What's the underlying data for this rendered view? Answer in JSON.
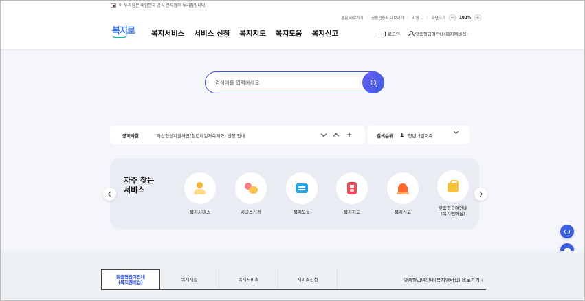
{
  "gov_banner": {
    "text": "이 누리집은 대한민국 공식 전자정부 누리집입니다."
  },
  "utility": {
    "skip": "본문 바로가기",
    "cert": "공동인증서 내보내기",
    "region": "지원",
    "zoom_label": "화면크기",
    "zoom_value": "100%",
    "zoom_out": "−",
    "zoom_in": "+"
  },
  "logo": {
    "text": "복지로"
  },
  "gnb": [
    "복지서비스",
    "서비스 신청",
    "복지지도",
    "복지도움",
    "복지신고"
  ],
  "member": {
    "login": "로그인",
    "membership": "맞춤형급여안내(복지멤버십)"
  },
  "search": {
    "placeholder": "검색어를 입력하세요"
  },
  "notice": {
    "label": "공지사항",
    "text": "자산형성지원사업(청년내일저축계좌) 신청 안내",
    "plus": "+"
  },
  "ranking": {
    "label": "검색순위",
    "rank": "1",
    "keyword": "청년내일저축"
  },
  "frequent": {
    "title": "자주 찾는\n서비스",
    "items": [
      {
        "label": "복지서비스",
        "icon": "people-icon"
      },
      {
        "label": "서비스신청",
        "icon": "hand-icon"
      },
      {
        "label": "복지도움",
        "icon": "book-icon"
      },
      {
        "label": "복지지도",
        "icon": "map-icon"
      },
      {
        "label": "복지신고",
        "icon": "bell-icon"
      },
      {
        "label": "맞춤형급여안내\n(복지멤버십)",
        "icon": "bag-icon"
      }
    ]
  },
  "bottom": {
    "tabs": [
      "맞춤형급여안내\n(복지멤버십)",
      "복지지갑",
      "복지서비스",
      "서비스신청"
    ],
    "shortcut": "맞춤형급여안내(복지멤버십) 바로가기 ›"
  },
  "colors": {
    "accent": "#3b5fe0",
    "brand": "#2f6bff",
    "tab_active": "#1f47d8"
  }
}
